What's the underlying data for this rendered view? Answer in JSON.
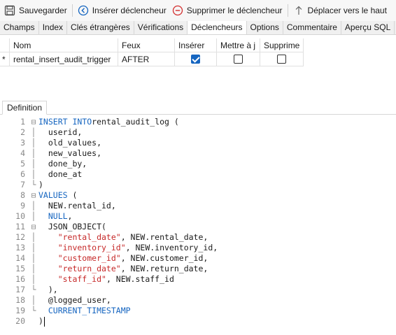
{
  "toolbar": {
    "save_label": "Sauvegarder",
    "insert_trigger_label": "Insérer déclencheur",
    "delete_trigger_label": "Supprimer le déclencheur",
    "move_up_label": "Déplacer vers le haut"
  },
  "tabs": [
    {
      "label": "Champs"
    },
    {
      "label": "Index"
    },
    {
      "label": "Clés étrangères"
    },
    {
      "label": "Vérifications"
    },
    {
      "label": "Déclencheurs"
    },
    {
      "label": "Options"
    },
    {
      "label": "Commentaire"
    },
    {
      "label": "Aperçu SQL"
    }
  ],
  "active_tab": "Déclencheurs",
  "grid": {
    "columns": [
      "Nom",
      "Feux",
      "Insérer",
      "Mettre à j",
      "Supprime"
    ],
    "rows": [
      {
        "marker": "*",
        "name": "rental_insert_audit_trigger",
        "feux": "AFTER",
        "insert": true,
        "update": false,
        "delete": false
      }
    ]
  },
  "definition": {
    "tab_label": "Definition",
    "lines": [
      {
        "n": "1",
        "fold": "⊟",
        "parts": [
          [
            "kw",
            "INSERT INTO"
          ],
          [
            "",
            "rental_audit_log ("
          ]
        ]
      },
      {
        "n": "2",
        "fold": "│",
        "parts": [
          [
            "",
            "  userid,"
          ]
        ]
      },
      {
        "n": "3",
        "fold": "│",
        "parts": [
          [
            "",
            "  old_values,"
          ]
        ]
      },
      {
        "n": "4",
        "fold": "│",
        "parts": [
          [
            "",
            "  new_values,"
          ]
        ]
      },
      {
        "n": "5",
        "fold": "│",
        "parts": [
          [
            "",
            "  done_by,"
          ]
        ]
      },
      {
        "n": "6",
        "fold": "│",
        "parts": [
          [
            "",
            "  done_at"
          ]
        ]
      },
      {
        "n": "7",
        "fold": "└",
        "parts": [
          [
            "",
            ")"
          ]
        ]
      },
      {
        "n": "8",
        "fold": "⊟",
        "parts": [
          [
            "kw",
            "VALUES"
          ],
          [
            "",
            " ("
          ]
        ]
      },
      {
        "n": "9",
        "fold": "│",
        "parts": [
          [
            "",
            "  NEW.rental_id,"
          ]
        ]
      },
      {
        "n": "10",
        "fold": "│",
        "parts": [
          [
            "kw",
            "  NULL"
          ],
          [
            "",
            ","
          ]
        ]
      },
      {
        "n": "11",
        "fold": "⊟",
        "parts": [
          [
            "",
            "  JSON_OBJECT("
          ]
        ]
      },
      {
        "n": "12",
        "fold": "│",
        "parts": [
          [
            "str",
            "    \"rental_date\""
          ],
          [
            "",
            ", NEW.rental_date,"
          ]
        ]
      },
      {
        "n": "13",
        "fold": "│",
        "parts": [
          [
            "str",
            "    \"inventory_id\""
          ],
          [
            "",
            ", NEW.inventory_id,"
          ]
        ]
      },
      {
        "n": "14",
        "fold": "│",
        "parts": [
          [
            "str",
            "    \"customer_id\""
          ],
          [
            "",
            ", NEW.customer_id,"
          ]
        ]
      },
      {
        "n": "15",
        "fold": "│",
        "parts": [
          [
            "str",
            "    \"return_date\""
          ],
          [
            "",
            ", NEW.return_date,"
          ]
        ]
      },
      {
        "n": "16",
        "fold": "│",
        "parts": [
          [
            "str",
            "    \"staff_id\""
          ],
          [
            "",
            ", NEW.staff_id"
          ]
        ]
      },
      {
        "n": "17",
        "fold": "└",
        "parts": [
          [
            "",
            "  ),"
          ]
        ]
      },
      {
        "n": "18",
        "fold": "│",
        "parts": [
          [
            "",
            "  @logged_user,"
          ]
        ]
      },
      {
        "n": "19",
        "fold": "└",
        "parts": [
          [
            "kw",
            "  CURRENT_TIMESTAMP"
          ]
        ]
      },
      {
        "n": "20",
        "fold": "",
        "parts": [
          [
            "",
            ")"
          ]
        ]
      }
    ]
  },
  "colors": {
    "keyword": "#1565c0",
    "string": "#c62828",
    "checkbox_checked": "#1565c0"
  }
}
